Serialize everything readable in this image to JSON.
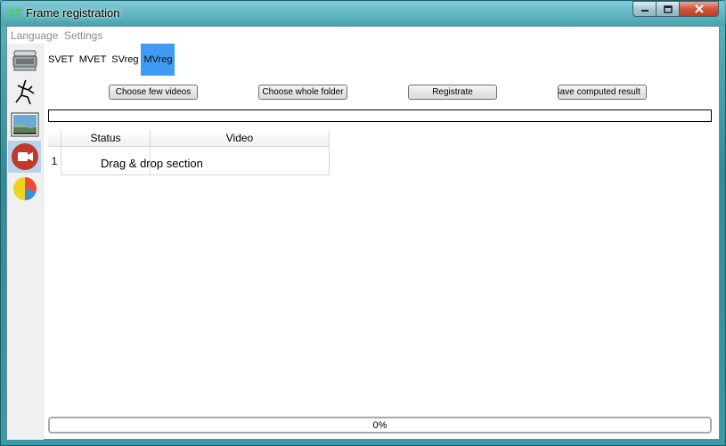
{
  "window": {
    "title": "Frame registration"
  },
  "menu": [
    "Language",
    "Settings"
  ],
  "sidebar": {
    "items": [
      {
        "icon": "drive-icon"
      },
      {
        "icon": "stick-figure-icon"
      },
      {
        "icon": "image-icon"
      },
      {
        "icon": "video-camera-icon",
        "active": true
      },
      {
        "icon": "pie-chart-icon"
      }
    ]
  },
  "tabs": [
    {
      "label": "SVET"
    },
    {
      "label": "MVET"
    },
    {
      "label": "SVreg"
    },
    {
      "label": "MVreg",
      "active": true
    }
  ],
  "buttons": {
    "choose_videos": "Choose few videos",
    "choose_folder": "Choose whole folder",
    "registrate": "Registrate",
    "save_result": "Save computed result"
  },
  "table": {
    "headers": [
      "Status",
      "Video"
    ],
    "rows": [
      {
        "num": "1",
        "status": "",
        "video": ""
      }
    ],
    "drop_hint": "Drag & drop section"
  },
  "progress": {
    "value": 0,
    "label": "0%"
  },
  "colors": {
    "active_tab": "#3e9cf4",
    "window_frame": "#3f9aa6",
    "close_button": "#c23b22"
  }
}
